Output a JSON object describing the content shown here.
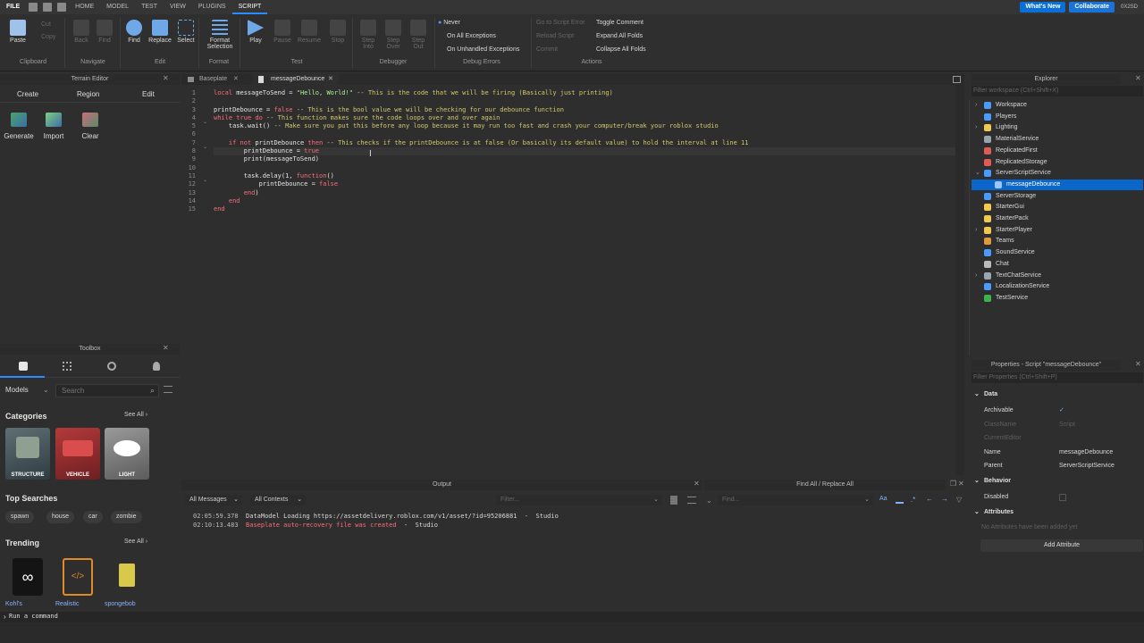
{
  "menubar": {
    "file": "FILE",
    "tabs": [
      "HOME",
      "MODEL",
      "TEST",
      "VIEW",
      "PLUGINS",
      "SCRIPT"
    ],
    "active_tab": "SCRIPT",
    "whats_new": "What's New",
    "collaborate": "Collaborate",
    "user": "0X2SD"
  },
  "ribbon": {
    "clipboard": {
      "paste": "Paste",
      "cut": "Cut",
      "copy": "Copy",
      "group": "Clipboard"
    },
    "navigate": {
      "back": "Back",
      "find": "Find",
      "group": "Navigate"
    },
    "edit": {
      "find": "Find",
      "replace": "Replace",
      "select": "Select",
      "group": "Edit"
    },
    "format": {
      "label": "Format Selection",
      "group": "Format"
    },
    "test": {
      "play": "Play",
      "pause": "Pause",
      "resume": "Resume",
      "stop": "Stop",
      "group": "Test"
    },
    "debugger": {
      "step_into": "Step Into",
      "step_over": "Step Over",
      "step_out": "Step Out",
      "group": "Debugger"
    },
    "debug_errors": {
      "never": "Never",
      "on_all": "On All Exceptions",
      "on_unhandled": "On Unhandled Exceptions",
      "group": "Debug Errors"
    },
    "actions": {
      "go_to_script": "Go to Script Error",
      "reload": "Reload Script",
      "commit": "Commit",
      "toggle_comment": "Toggle Comment",
      "expand": "Expand All Folds",
      "collapse": "Collapse All Folds",
      "group": "Actions"
    }
  },
  "terrain": {
    "title": "Terrain Editor",
    "tabs": [
      "Create",
      "Region",
      "Edit"
    ],
    "tools": [
      "Generate",
      "Import",
      "Clear"
    ]
  },
  "toolbox": {
    "title": "Toolbox",
    "category_select": "Models",
    "search_placeholder": "Search",
    "categories_label": "Categories",
    "see_all": "See All",
    "categories": [
      "STRUCTURE",
      "VEHICLE",
      "LIGHT"
    ],
    "top_searches_label": "Top Searches",
    "top_searches": [
      "spawn",
      "house",
      "car",
      "zombie"
    ],
    "trending_label": "Trending",
    "trending": [
      "Kohl's",
      "Realistic",
      "spongebob"
    ]
  },
  "editor": {
    "tabs": [
      "Baseplate",
      "messageDebounce"
    ],
    "line_numbers": [
      "1",
      "2",
      "3",
      "4",
      "5",
      "6",
      "7",
      "8",
      "9",
      "10",
      "11",
      "12",
      "13",
      "14",
      "15"
    ]
  },
  "explorer": {
    "title": "Explorer",
    "filter_placeholder": "Filter workspace (Ctrl+Shift+X)",
    "items": [
      {
        "label": "Workspace",
        "color": "#4a9bff"
      },
      {
        "label": "Players",
        "color": "#4a9bff"
      },
      {
        "label": "Lighting",
        "color": "#f2c94c"
      },
      {
        "label": "MaterialService",
        "color": "#9aa5b1"
      },
      {
        "label": "ReplicatedFirst",
        "color": "#e05a5a"
      },
      {
        "label": "ReplicatedStorage",
        "color": "#e05a5a"
      },
      {
        "label": "ServerScriptService",
        "color": "#4a9bff"
      },
      {
        "label": "messageDebounce",
        "color": "#9fc4ff"
      },
      {
        "label": "ServerStorage",
        "color": "#4a9bff"
      },
      {
        "label": "StarterGui",
        "color": "#f2c94c"
      },
      {
        "label": "StarterPack",
        "color": "#f2c94c"
      },
      {
        "label": "StarterPlayer",
        "color": "#f2c94c"
      },
      {
        "label": "Teams",
        "color": "#e09a3a"
      },
      {
        "label": "SoundService",
        "color": "#4a9bff"
      },
      {
        "label": "Chat",
        "color": "#bbbbbb"
      },
      {
        "label": "TextChatService",
        "color": "#9aa5b1"
      },
      {
        "label": "LocalizationService",
        "color": "#4a9bff"
      },
      {
        "label": "TestService",
        "color": "#3bb54a"
      }
    ]
  },
  "properties": {
    "title": "Properties - Script \"messageDebounce\"",
    "filter_placeholder": "Filter Properties (Ctrl+Shift+P)",
    "data_label": "Data",
    "archivable": "Archivable",
    "classname": "ClassName",
    "classname_value": "Script",
    "current_editor": "CurrentEditor",
    "name_label": "Name",
    "name_value": "messageDebounce",
    "parent_label": "Parent",
    "parent_value": "ServerScriptService",
    "behavior_label": "Behavior",
    "disabled_label": "Disabled",
    "attributes_label": "Attributes",
    "no_attributes": "No Attributes have been added yet",
    "add_attribute": "Add Attribute"
  },
  "output": {
    "title": "Output",
    "messages_filter": "All Messages",
    "contexts_filter": "All Contexts",
    "filter_placeholder": "Filter...",
    "lines": [
      {
        "time": "02:05:59.378",
        "text": "DataModel Loading https://assetdelivery.roblox.com/v1/asset/?id=95206881",
        "src": "Studio",
        "color": "#d8d8d8"
      },
      {
        "time": "02:10:13.483",
        "text": "Baseplate auto-recovery file was created",
        "src": "Studio",
        "color": "#f86d7c"
      }
    ]
  },
  "find_replace": {
    "title": "Find All / Replace All",
    "find_placeholder": "Find..."
  },
  "command_bar": {
    "placeholder": "Run a command"
  }
}
